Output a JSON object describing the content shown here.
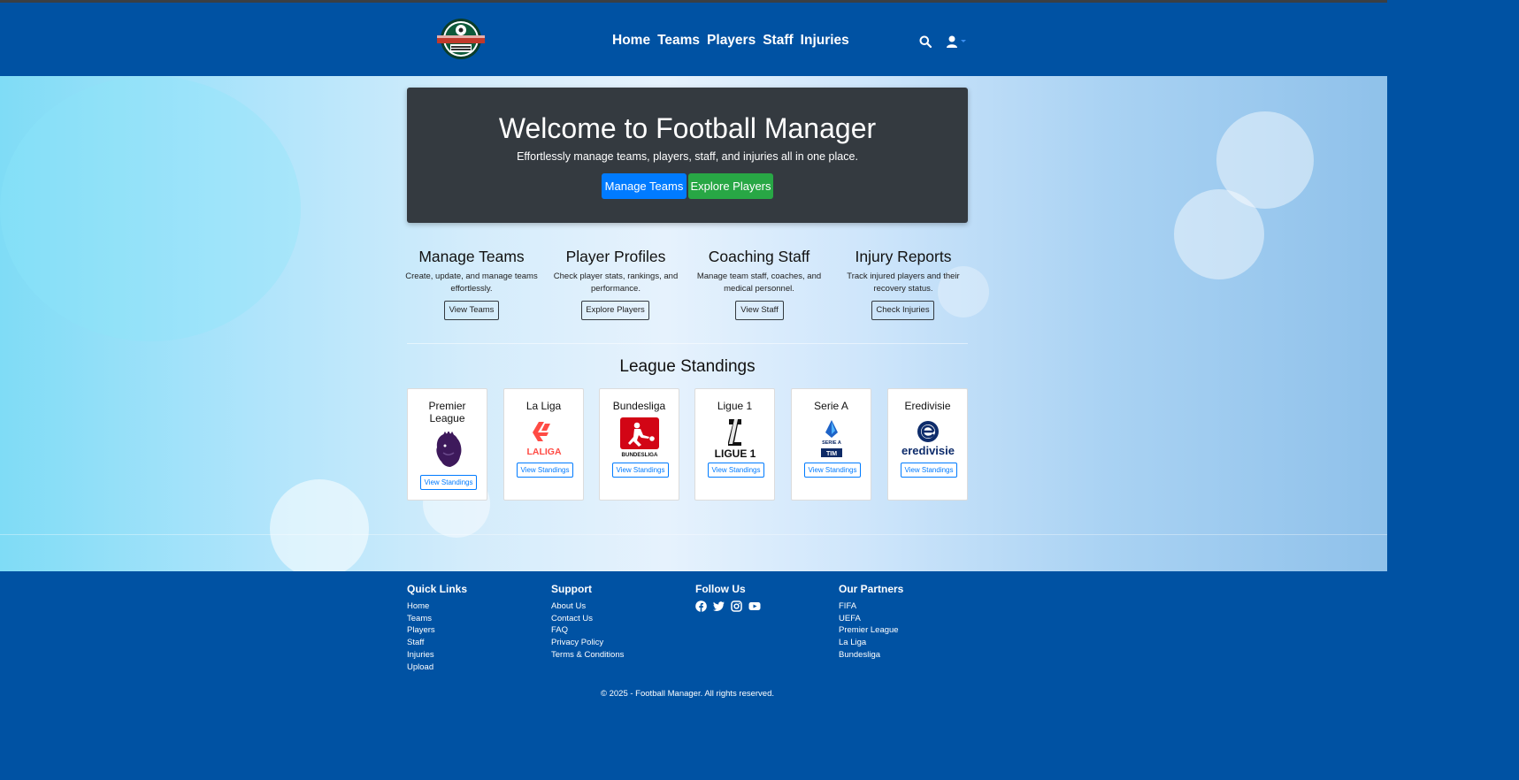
{
  "nav": {
    "links": [
      "Home",
      "Teams",
      "Players",
      "Staff",
      "Injuries"
    ],
    "search_icon": "search-icon",
    "user_icon": "user-icon"
  },
  "hero": {
    "title": "Welcome to Football Manager",
    "subtitle": "Effortlessly manage teams, players, staff, and injuries all in one place.",
    "primary_button": "Manage Teams",
    "secondary_button": "Explore Players"
  },
  "features": [
    {
      "title": "Manage Teams",
      "text": "Create, update, and manage teams effortlessly.",
      "button": "View Teams"
    },
    {
      "title": "Player Profiles",
      "text": "Check player stats, rankings, and performance.",
      "button": "Explore Players"
    },
    {
      "title": "Coaching Staff",
      "text": "Manage team staff, coaches, and medical personnel.",
      "button": "View Staff"
    },
    {
      "title": "Injury Reports",
      "text": "Track injured players and their recovery status.",
      "button": "Check Injuries"
    }
  ],
  "standings": {
    "title": "League Standings",
    "leagues": [
      {
        "name": "Premier League",
        "logo": "premier-league-lion",
        "button": "View Standings"
      },
      {
        "name": "La Liga",
        "logo": "laliga-logo",
        "logo_text": "LALIGA",
        "button": "View Standings"
      },
      {
        "name": "Bundesliga",
        "logo": "bundesliga-logo",
        "logo_text": "BUNDESLIGA",
        "button": "View Standings"
      },
      {
        "name": "Ligue 1",
        "logo": "ligue1-logo",
        "logo_text": "LIGUE 1",
        "button": "View Standings"
      },
      {
        "name": "Serie A",
        "logo": "serie-a-logo",
        "logo_text": "SERIE A",
        "logo_sub": "TIM",
        "button": "View Standings"
      },
      {
        "name": "Eredivisie",
        "logo": "eredivisie-logo",
        "logo_text": "eredivisie",
        "button": "View Standings"
      }
    ]
  },
  "footer": {
    "quick_links": {
      "title": "Quick Links",
      "items": [
        "Home",
        "Teams",
        "Players",
        "Staff",
        "Injuries",
        "Upload"
      ]
    },
    "support": {
      "title": "Support",
      "items": [
        "About Us",
        "Contact Us",
        "FAQ",
        "Privacy Policy",
        "Terms & Conditions"
      ]
    },
    "follow": {
      "title": "Follow Us",
      "icons": [
        "facebook-icon",
        "twitter-icon",
        "instagram-icon",
        "youtube-icon"
      ]
    },
    "partners": {
      "title": "Our Partners",
      "items": [
        "FIFA",
        "UEFA",
        "Premier League",
        "La Liga",
        "Bundesliga"
      ]
    },
    "copyright": "© 2025 - Football Manager. All rights reserved."
  },
  "colors": {
    "navbar": "#0052a3",
    "jumbotron": "#343a40",
    "primary": "#007bff",
    "success": "#28a745"
  }
}
